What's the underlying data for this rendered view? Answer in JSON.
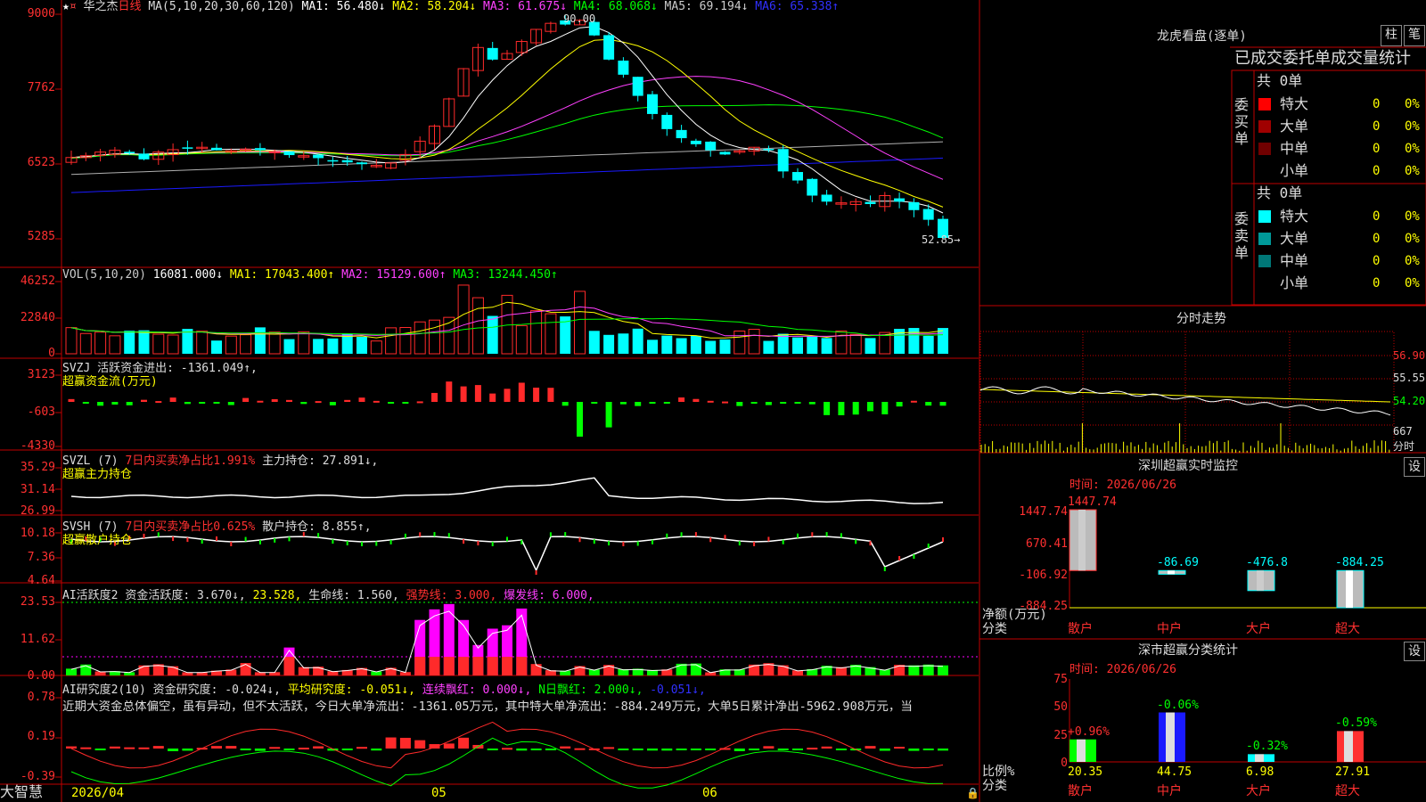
{
  "stock": {
    "name": "华之杰",
    "period": "日线"
  },
  "colors": {
    "up": "#ff2a2a",
    "down": "#00ffff",
    "frame": "#c00000",
    "ma1": "#ffffff",
    "ma2": "#ffff00",
    "ma3": "#ff40ff",
    "ma4": "#00ff00",
    "ma5": "#b0b0b0",
    "ma6": "#1a1aff",
    "buy_bar": "#ff00ff",
    "green": "#00ff00"
  },
  "price_panel": {
    "legend": {
      "ma_params": "MA(5,10,20,30,60,120)",
      "ma1": "MA1: 56.480↓",
      "ma2": "MA2: 58.204↓",
      "ma3": "MA3: 61.675↓",
      "ma4": "MA4: 68.068↓",
      "ma5": "MA5: 69.194↓",
      "ma6": "MA6: 65.338↑"
    },
    "yticks": [
      "9000",
      "7762",
      "6523",
      "5285"
    ],
    "high_label": "90.00",
    "last_label": "52.85→"
  },
  "vol_panel": {
    "legend": {
      "title": "VOL(5,10,20)",
      "value": "16081.000↓",
      "ma1": "MA1: 17043.400↑",
      "ma2": "MA2: 15129.600↑",
      "ma3": "MA3: 13244.450↑"
    },
    "yticks": [
      "46252",
      "22840",
      "0"
    ]
  },
  "svzj_panel": {
    "legend": {
      "title": "SVZJ",
      "item": "活跃资金进出: -1361.049↑,",
      "sub": "超赢资金流(万元)"
    },
    "yticks": [
      "3123",
      "-603",
      "-4330"
    ]
  },
  "svzl_panel": {
    "legend": {
      "title": "SVZL (7)",
      "item1": "7日内买卖净占比1.991%",
      "item2": "主力持仓: 27.891↓,",
      "sub": "超赢主力持仓"
    },
    "yticks": [
      "35.29",
      "31.14",
      "26.99"
    ]
  },
  "svsh_panel": {
    "legend": {
      "title": "SVSH (7)",
      "item1": "7日内买卖净占比0.625%",
      "item2": "散户持仓: 8.855↑,",
      "sub": "超赢散户持仓"
    },
    "yticks": [
      "10.18",
      "7.36",
      "4.64"
    ]
  },
  "ai_active_panel": {
    "legend": {
      "title": "AI活跃度2",
      "item1": "资金活跃度: 3.670↓,",
      "item2": "23.528,",
      "item3": "生命线: 1.560,",
      "item4": "强势线: 3.000,",
      "item5": "爆发线: 6.000,"
    },
    "yticks": [
      "23.53",
      "11.62",
      "0.00"
    ]
  },
  "ai_research_panel": {
    "legend": {
      "title": "AI研究度2(10)",
      "item1": "资金研究度: -0.024↓,",
      "item2": "平均研究度: -0.051↓,",
      "item3": "连续飘红: 0.000↓,",
      "item4": "N日飘红: 2.000↓,",
      "item5": "-0.051↓,"
    },
    "commentary": "近期大资金总体偏空，虽有异动，但不太活跃，今日大单净流出：-1361.05万元，其中特大单净流出：-884.249万元，大单5日累计净出-5962.908万元，当",
    "yticks": [
      "0.78",
      "0.19",
      "-0.39"
    ]
  },
  "xaxis": {
    "labels": [
      "2026/04",
      "05",
      "06"
    ]
  },
  "footer": {
    "logo": "大智慧"
  },
  "dragon_tiger": {
    "title": "龙虎看盘(逐单)",
    "btn_bar": "柱",
    "btn_pen": "笔",
    "header": "已成交委托单成交量统计",
    "buy_label": "委买单",
    "sell_label": "委卖单",
    "buy_total": "共 0单",
    "sell_total": "共 0单",
    "buy_rows": [
      {
        "label": "特大",
        "count": "0",
        "pct": "0%",
        "color": "#ff0000"
      },
      {
        "label": "大单",
        "count": "0",
        "pct": "0%",
        "color": "#a00000"
      },
      {
        "label": "中单",
        "count": "0",
        "pct": "0%",
        "color": "#700000"
      },
      {
        "label": "小单",
        "count": "0",
        "pct": "0%",
        "color": ""
      }
    ],
    "sell_rows": [
      {
        "label": "特大",
        "count": "0",
        "pct": "0%",
        "color": "#00ffff"
      },
      {
        "label": "大单",
        "count": "0",
        "pct": "0%",
        "color": "#009999"
      },
      {
        "label": "中单",
        "count": "0",
        "pct": "0%",
        "color": "#007777"
      },
      {
        "label": "小单",
        "count": "0",
        "pct": "0%",
        "color": ""
      }
    ]
  },
  "intraday": {
    "title": "分时走势",
    "yticks": [
      "56.90",
      "55.55",
      "54.20"
    ],
    "vol_label": "667",
    "vol_unit": "分时"
  },
  "sz_monitor": {
    "title": "深圳超赢实时监控",
    "settings": "设",
    "time": "时间: 2026/06/26",
    "yticks": [
      "1447.74",
      "670.41",
      "-106.92",
      "-884.25"
    ],
    "ylabel": "净额(万元)",
    "xlabel": "分类",
    "bars": [
      {
        "category": "散户",
        "value": 1447.74,
        "label": "1447.74"
      },
      {
        "category": "中户",
        "value": -86.69,
        "label": "-86.69"
      },
      {
        "category": "大户",
        "value": -476.8,
        "label": "-476.8"
      },
      {
        "category": "超大",
        "value": -884.25,
        "label": "-884.25"
      }
    ]
  },
  "sz_class": {
    "title": "深市超赢分类统计",
    "settings": "设",
    "time": "时间: 2026/06/26",
    "yticks": [
      "75",
      "50",
      "25",
      "0"
    ],
    "ylabel": "比例%",
    "xlabel": "分类",
    "bars": [
      {
        "category": "散户",
        "value": 20.35,
        "label": "20.35",
        "change": "+0.96%"
      },
      {
        "category": "中户",
        "value": 44.75,
        "label": "44.75",
        "change": "-0.06%"
      },
      {
        "category": "大户",
        "value": 6.98,
        "label": "6.98",
        "change": "-0.32%"
      },
      {
        "category": "超大",
        "value": 27.91,
        "label": "27.91",
        "change": "-0.59%"
      }
    ]
  },
  "chart_data": [
    {
      "type": "bar",
      "title": "深圳超赢实时监控",
      "categories": [
        "散户",
        "中户",
        "大户",
        "超大"
      ],
      "values": [
        1447.74,
        -86.69,
        -476.8,
        -884.25
      ],
      "xlabel": "分类",
      "ylabel": "净额(万元)",
      "ylim": [
        -884.25,
        1447.74
      ]
    },
    {
      "type": "bar",
      "title": "深市超赢分类统计",
      "categories": [
        "散户",
        "中户",
        "大户",
        "超大"
      ],
      "values": [
        20.35,
        44.75,
        6.98,
        27.91
      ],
      "xlabel": "分类",
      "ylabel": "比例%",
      "ylim": [
        0,
        75
      ]
    }
  ]
}
